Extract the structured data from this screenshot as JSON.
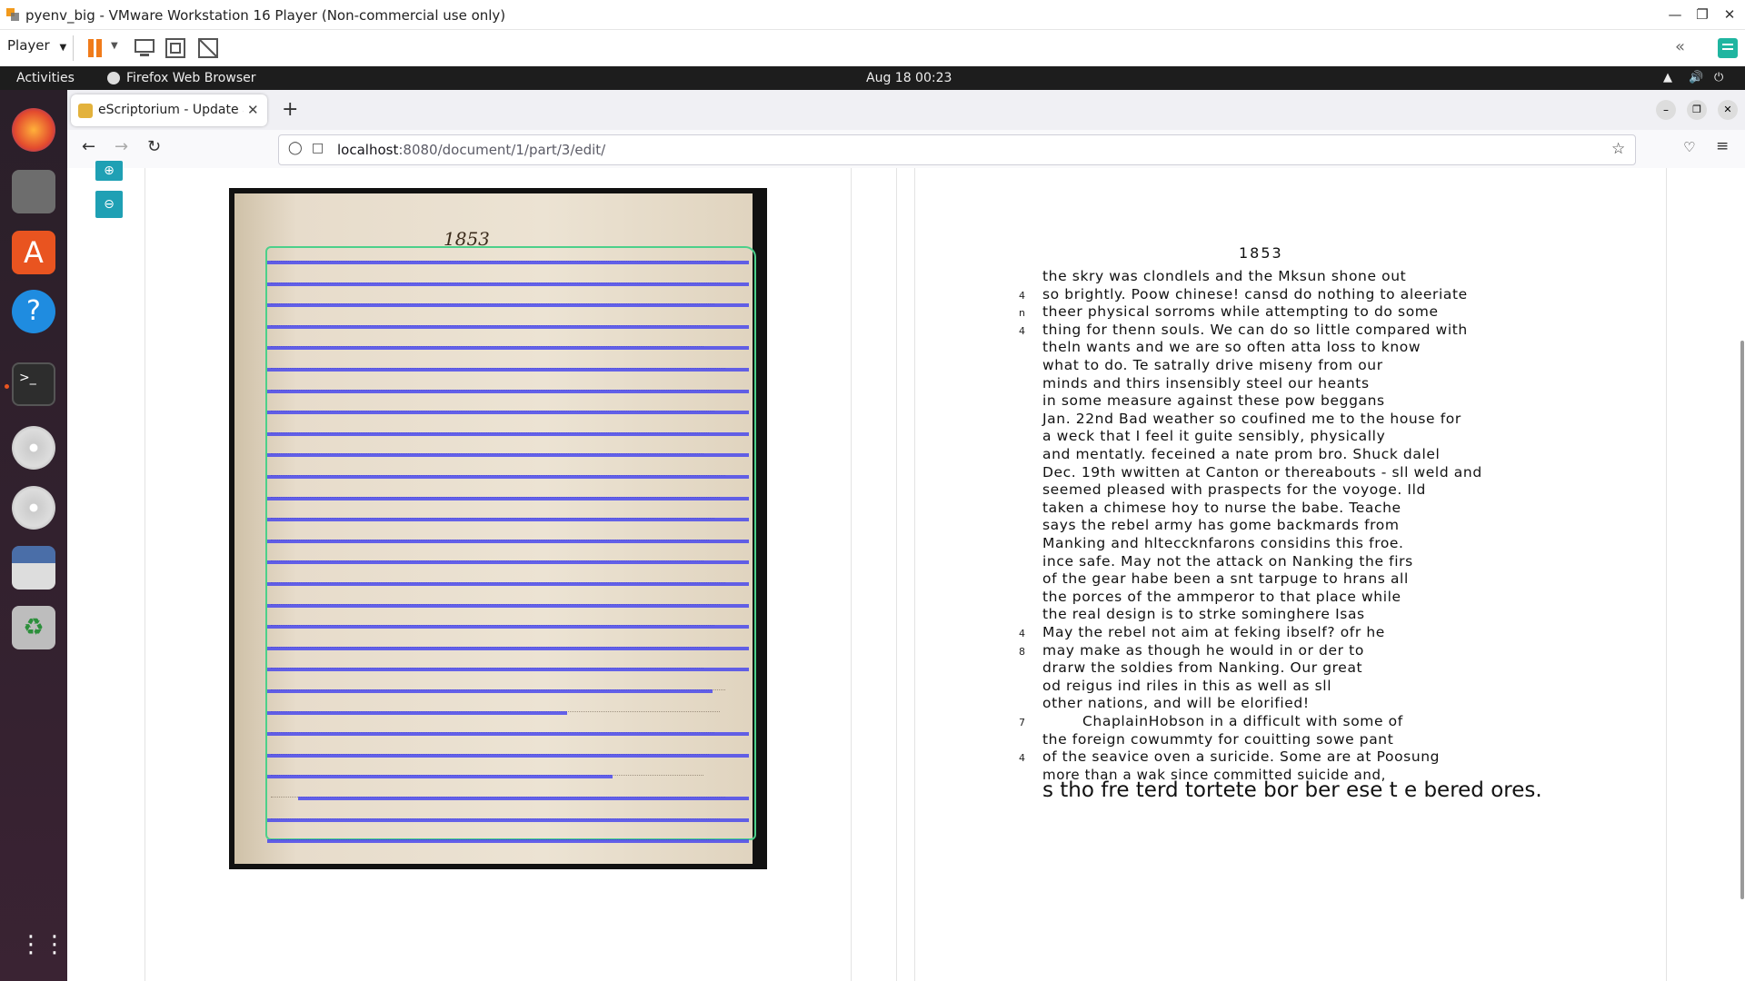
{
  "vmware": {
    "title": "pyenv_big - VMware Workstation 16 Player (Non-commercial use only)",
    "player_menu": "Player",
    "icons": [
      "pause-icon",
      "send-ctrl-alt-del-icon",
      "fullscreen-icon",
      "unity-icon",
      "collapse-icon",
      "notes-icon"
    ]
  },
  "topbar": {
    "activities": "Activities",
    "app_name": "Firefox Web Browser",
    "clock": "Aug 18  00:23"
  },
  "browser": {
    "tab_title": "eScriptorium - Update a D",
    "url_host": "localhost",
    "url_rest": ":8080/document/1/part/3/edit/"
  },
  "colors": {
    "baseline": "#3c3cf0",
    "region": "#4cd08a",
    "zoom_button": "#1fa0b4"
  },
  "manuscript": {
    "year_label": "1853",
    "baseline_count": 28
  },
  "transcription": {
    "heading": "1853",
    "lines": [
      "the skry was clondlels and the Mksun shone out",
      "so brightly. Poow chinese! cansd do nothing to aleeriate",
      "theer physical sorroms while attempting to do some",
      "thing for thenn souls. We can do so little compared with",
      "theln wants and we are so often atta loss to know",
      "what to do. Te satrally drive miseny from our",
      "minds and thirs insensibly steel our heants",
      "in some measure against these pow beggans",
      "Jan. 22nd Bad weather so coufined me to the house for",
      "a weck that I feel it guite sensibly, physically",
      "and mentatly. feceined a nate prom bro. Shuck dalel",
      "Dec. 19th wwitten at Canton or thereabouts - sll weld and",
      "seemed pleased with praspects for the voyoge. Ild",
      "taken a chimese hoy to nurse the babe. Teache",
      "says the rebel army has gome backmards from",
      "Manking and hlteccknfarons considins this froe.",
      "ince safe. May not the attack on Nanking the firs",
      "of the gear habe been a snt tarpuge to hrans all",
      "the porces of the ammperor to that place while",
      "the real design is to strke sominghere Isas",
      "May the rebel not aim at feking ibself? ofr he",
      "may make as though he would in or der to",
      "drarw the soldies from Nanking. Our great",
      "od reigus ind riles in this as well as sll",
      "other nations, and will be elorified!",
      "ChaplainHobson in a difficult with some of",
      "the foreign cowummty for couitting sowe pant",
      "of the seavice oven a suricide. Some are at Poosung",
      "more than a wak since committed suicide and,",
      "s tho fre terd tortete bor ber ese t e bered ores."
    ],
    "line_numbers": [
      "4",
      "n",
      "4",
      "4",
      "8",
      "7",
      "4"
    ]
  }
}
